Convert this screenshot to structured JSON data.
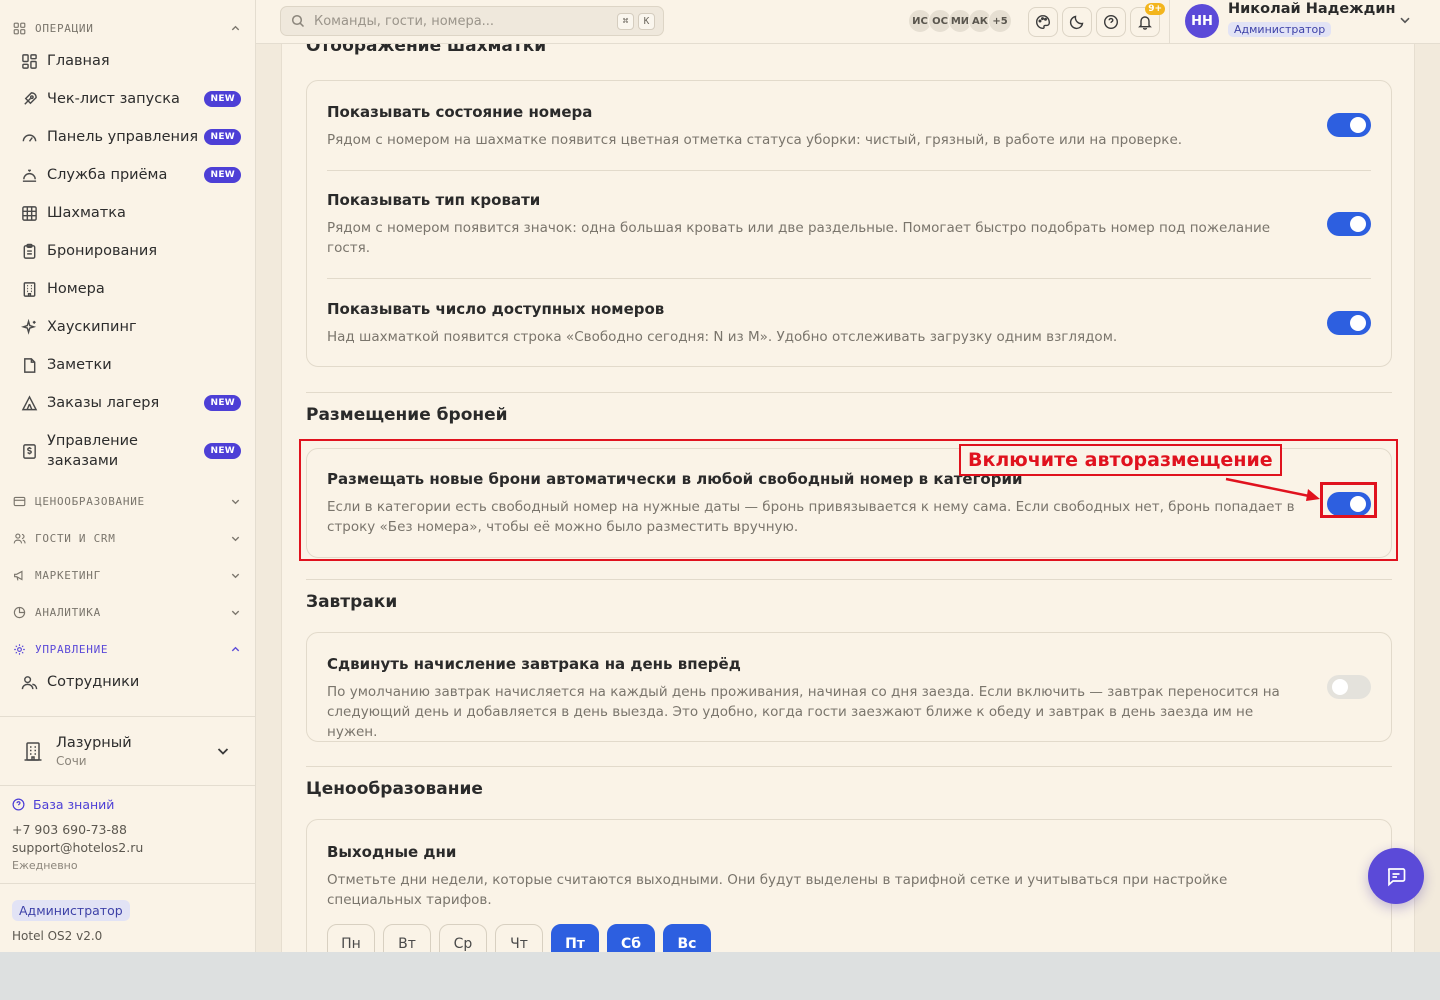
{
  "sidebar": {
    "sections": {
      "operations": "ОПЕРАЦИИ",
      "pricing": "ЦЕНООБРАЗОВАНИЕ",
      "guests": "ГОСТИ И CRM",
      "marketing": "МАРКЕТИНГ",
      "analytics": "АНАЛИТИКА",
      "management": "УПРАВЛЕНИЕ"
    },
    "items": [
      {
        "label": "Главная",
        "icon": "home-grid-icon"
      },
      {
        "label": "Чек-лист запуска",
        "icon": "rocket-icon",
        "badge": "NEW"
      },
      {
        "label": "Панель управления",
        "icon": "gauge-icon",
        "badge": "NEW"
      },
      {
        "label": "Служба приёма",
        "icon": "bell-desk-icon",
        "badge": "NEW"
      },
      {
        "label": "Шахматка",
        "icon": "grid-icon"
      },
      {
        "label": "Бронирования",
        "icon": "clipboard-icon"
      },
      {
        "label": "Номера",
        "icon": "building-icon"
      },
      {
        "label": "Хаускипинг",
        "icon": "sparkles-icon"
      },
      {
        "label": "Заметки",
        "icon": "note-icon"
      },
      {
        "label": "Заказы лагеря",
        "icon": "tent-icon",
        "badge": "NEW"
      },
      {
        "label": "Управление заказами",
        "icon": "dollar-doc-icon",
        "badge": "NEW"
      },
      {
        "label": "Сотрудники",
        "icon": "users-icon"
      }
    ],
    "hotel": {
      "name": "Лазурный",
      "city": "Сочи"
    },
    "support": {
      "kb_label": "База знаний",
      "phone": "+7 903 690-73-88",
      "email": "support@hotelos2.ru",
      "hours": "Ежедневно"
    },
    "footer": {
      "role": "Администратор",
      "version": "Hotel OS2 v2.0"
    }
  },
  "topbar": {
    "search_placeholder": "Команды, гости, номера...",
    "kbd1": "⌘",
    "kbd2": "K",
    "avatars": [
      "ИС",
      "ОС",
      "МИ",
      "АК",
      "+5"
    ],
    "notif_count": "9+",
    "user": {
      "initials": "НН",
      "name": "Николай Надеждин",
      "role": "Администратор"
    }
  },
  "main": {
    "chess": {
      "heading": "Отображение шахматки",
      "rows": [
        {
          "title": "Показывать состояние номера",
          "desc": "Рядом с номером на шахматке появится цветная отметка статуса уборки: чистый, грязный, в работе или на проверке.",
          "on": true
        },
        {
          "title": "Показывать тип кровати",
          "desc": "Рядом с номером появится значок: одна большая кровать или две раздельные. Помогает быстро подобрать номер под пожелание гостя.",
          "on": true
        },
        {
          "title": "Показывать число доступных номеров",
          "desc": "Над шахматкой появится строка «Свободно сегодня: N из M». Удобно отслеживать загрузку одним взглядом.",
          "on": true
        }
      ]
    },
    "placement": {
      "heading": "Размещение броней",
      "title": "Размещать новые брони автоматически в любой свободный номер в категории",
      "desc": "Если в категории есть свободный номер на нужные даты — бронь привязывается к нему сама. Если свободных нет, бронь попадает в строку «Без номера», чтобы её можно было разместить вручную.",
      "on": true
    },
    "breakfast": {
      "heading": "Завтраки",
      "title": "Сдвинуть начисление завтрака на день вперёд",
      "desc": "По умолчанию завтрак начисляется на каждый день проживания, начиная со дня заезда. Если включить — завтрак переносится на следующий день и добавляется в день выезда. Это удобно, когда гости заезжают ближе к обеду и завтрак в день заезда им не нужен.",
      "on": false
    },
    "pricing": {
      "heading": "Ценообразование",
      "title": "Выходные дни",
      "desc": "Отметьте дни недели, которые считаются выходными. Они будут выделены в тарифной сетке и учитываться при настройке специальных тарифов.",
      "days": [
        {
          "label": "Пн",
          "on": false
        },
        {
          "label": "Вт",
          "on": false
        },
        {
          "label": "Ср",
          "on": false
        },
        {
          "label": "Чт",
          "on": false
        },
        {
          "label": "Пт",
          "on": true
        },
        {
          "label": "Сб",
          "on": true
        },
        {
          "label": "Вс",
          "on": true
        }
      ]
    }
  },
  "annotation": {
    "label": "Включите авторазмещение",
    "color": "#e0121e"
  },
  "colors": {
    "accent": "#2d5fe0",
    "brand": "#5b4ad8",
    "background": "#faf3e7"
  }
}
